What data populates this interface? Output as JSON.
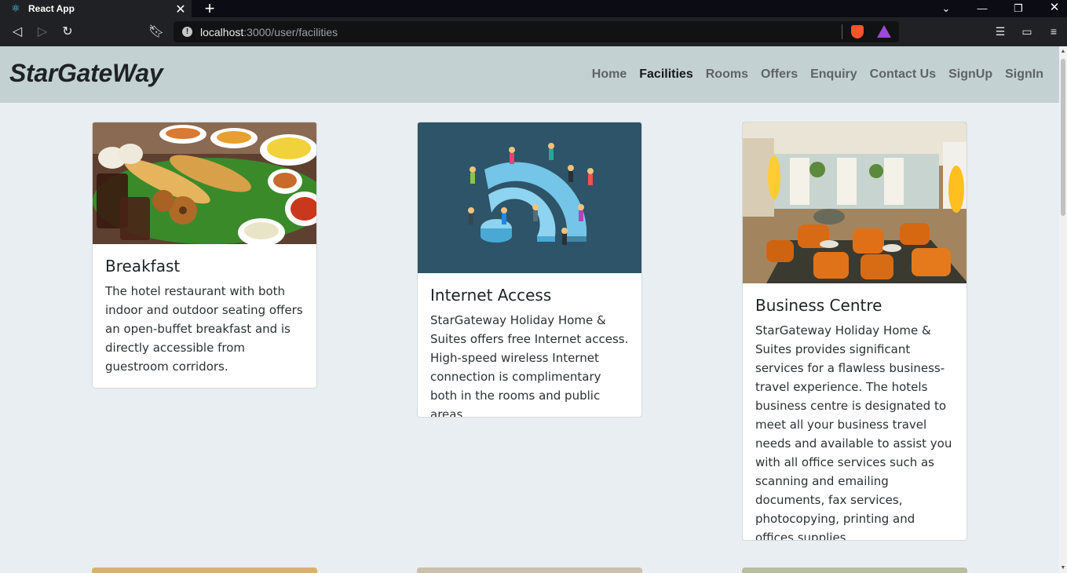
{
  "browser": {
    "tab_title": "React App",
    "url_host": "localhost",
    "url_rest": ":3000/user/facilities"
  },
  "site": {
    "brand": "StarGateWay",
    "nav": [
      {
        "label": "Home",
        "active": false
      },
      {
        "label": "Facilities",
        "active": true
      },
      {
        "label": "Rooms",
        "active": false
      },
      {
        "label": "Offers",
        "active": false
      },
      {
        "label": "Enquiry",
        "active": false
      },
      {
        "label": "Contact Us",
        "active": false
      },
      {
        "label": "SignUp",
        "active": false
      },
      {
        "label": "SignIn",
        "active": false
      }
    ]
  },
  "facilities": [
    {
      "title": "Breakfast",
      "text": "The hotel restaurant with both indoor and outdoor seating offers an open-buffet breakfast and is directly accessible from guestroom corridors."
    },
    {
      "title": "Internet Access",
      "text": "StarGateway Holiday Home & Suites offers free Internet access. High-speed wireless Internet connection is complimentary both in the rooms and public areas."
    },
    {
      "title": "Business Centre",
      "text": "StarGateway Holiday Home & Suites provides significant services for a flawless business-travel experience. The hotels business centre is designated to meet all your business travel needs and available to assist you with all office services such as scanning and emailing documents, fax services, photocopying, printing and offices supplies."
    }
  ]
}
